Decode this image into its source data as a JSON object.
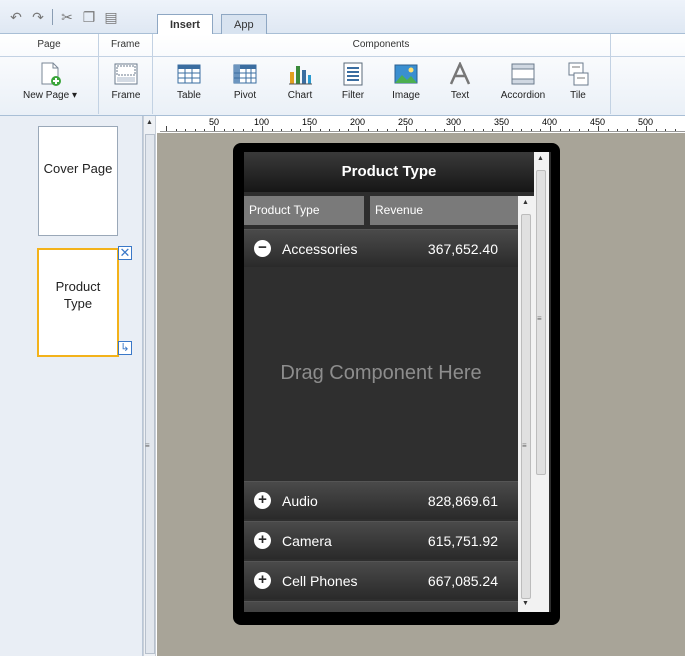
{
  "tabs": [
    {
      "label": "Insert",
      "active": true
    },
    {
      "label": "App",
      "active": false
    }
  ],
  "ribbon": {
    "groups": {
      "page": "Page",
      "frame": "Frame",
      "components": "Components"
    },
    "buttons": {
      "new_page": "New Page",
      "frame": "Frame",
      "table": "Table",
      "pivot": "Pivot",
      "chart": "Chart",
      "filter": "Filter",
      "image": "Image",
      "text": "Text",
      "accordion": "Accordion",
      "tile": "Tile"
    }
  },
  "ruler": {
    "ticks": [
      "50",
      "100",
      "150",
      "200",
      "250",
      "300",
      "350",
      "400",
      "450",
      "500"
    ]
  },
  "pages": [
    {
      "label": "Cover Page",
      "selected": false
    },
    {
      "label": "Product Type",
      "selected": true
    }
  ],
  "preview": {
    "title": "Product Type",
    "columns": [
      "Product Type",
      "Revenue"
    ],
    "rows": [
      {
        "name": "Accessories",
        "value": "367,652.40",
        "expanded": true
      },
      {
        "name": "Audio",
        "value": "828,869.61",
        "expanded": false
      },
      {
        "name": "Camera",
        "value": "615,751.92",
        "expanded": false
      },
      {
        "name": "Cell Phones",
        "value": "667,085.24",
        "expanded": false
      }
    ],
    "placeholder": "Drag Component Here"
  },
  "colors": {
    "accent": "#f3b21a",
    "canvas": "#a8a498",
    "device": "#000000"
  }
}
